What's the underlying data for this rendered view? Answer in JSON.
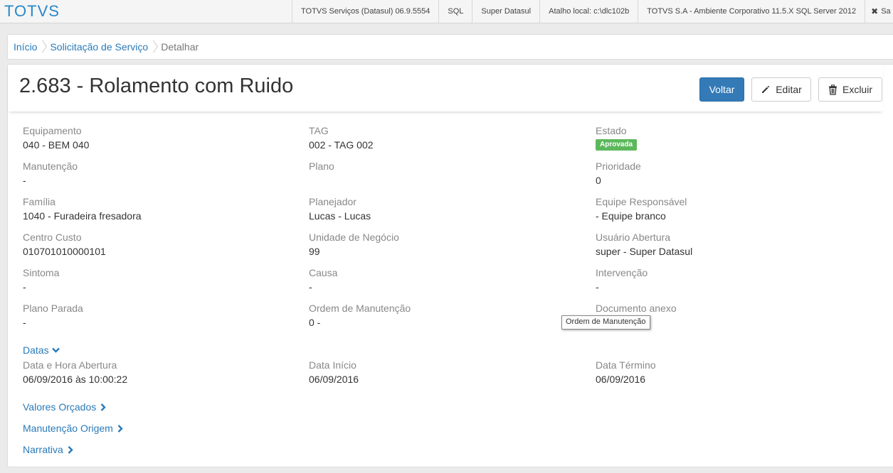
{
  "topbar": {
    "brand": "TOTVS",
    "items": [
      "TOTVS Serviços (Datasul) 06.9.5554",
      "SQL",
      "Super Datasul",
      "Atalho local: c:\\dlc102b",
      "TOTVS S.A - Ambiente Corporativo 11.5.X SQL Server 2012"
    ],
    "close_label": "Sa"
  },
  "breadcrumb": {
    "home": "Início",
    "parent": "Solicitação de Serviço",
    "current": "Detalhar"
  },
  "page": {
    "title": "2.683 - Rolamento com Ruido"
  },
  "buttons": {
    "back": "Voltar",
    "edit": "Editar",
    "delete": "Excluir"
  },
  "fields": {
    "equipamento": {
      "label": "Equipamento",
      "value": "040 - BEM 040"
    },
    "tag": {
      "label": "TAG",
      "value": "002 - TAG 002"
    },
    "estado": {
      "label": "Estado",
      "value": "Aprovada"
    },
    "manutencao": {
      "label": "Manutenção",
      "value": "-"
    },
    "plano": {
      "label": "Plano",
      "value": ""
    },
    "prioridade": {
      "label": "Prioridade",
      "value": "0"
    },
    "familia": {
      "label": "Família",
      "value": "1040 - Furadeira fresadora"
    },
    "planejador": {
      "label": "Planejador",
      "value": "Lucas - Lucas"
    },
    "equipe": {
      "label": "Equipe Responsável",
      "value": "- Equipe branco"
    },
    "centro_custo": {
      "label": "Centro Custo",
      "value": "010701010000101"
    },
    "unidade_negocio": {
      "label": "Unidade de Negócio",
      "value": "99"
    },
    "usuario_abertura": {
      "label": "Usuário Abertura",
      "value": "super - Super Datasul"
    },
    "sintoma": {
      "label": "Sintoma",
      "value": "-"
    },
    "causa": {
      "label": "Causa",
      "value": "-"
    },
    "intervencao": {
      "label": "Intervenção",
      "value": "-"
    },
    "plano_parada": {
      "label": "Plano Parada",
      "value": "-"
    },
    "ordem_manutencao": {
      "label": "Ordem de Manutenção",
      "value": "0 -"
    },
    "documento_anexo": {
      "label": "Documento anexo",
      "value": ""
    }
  },
  "datas": {
    "section_label": "Datas",
    "abertura": {
      "label": "Data e Hora Abertura",
      "value": "06/09/2016 às 10:00:22"
    },
    "inicio": {
      "label": "Data Início",
      "value": "06/09/2016"
    },
    "termino": {
      "label": "Data Término",
      "value": "06/09/2016"
    }
  },
  "sections": {
    "valores": "Valores Orçados",
    "origem": "Manutenção Origem",
    "narrativa": "Narrativa"
  },
  "tooltip": "Ordem de Manutenção",
  "colors": {
    "primary": "#337ab7",
    "link": "#2a7ab8",
    "brand": "#2a88c8",
    "badge_success": "#5cb85c"
  }
}
